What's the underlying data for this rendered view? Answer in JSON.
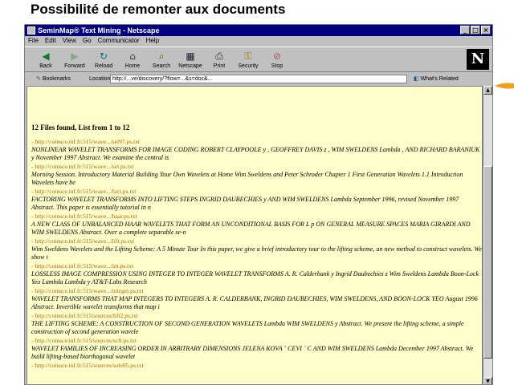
{
  "slide_title": "Possibilité de remonter aux documents",
  "window": {
    "title": "SeminMap® Text Mining - Netscape",
    "buttons": [
      "_",
      "□",
      "×"
    ]
  },
  "menu": [
    "File",
    "Edit",
    "View",
    "Go",
    "Communicator",
    "Help"
  ],
  "toolbar": [
    {
      "label": "Back",
      "icon": "back-arrow-icon"
    },
    {
      "label": "Forward",
      "icon": "forward-arrow-icon"
    },
    {
      "label": "Reload",
      "icon": "reload-icon"
    },
    {
      "label": "Home",
      "icon": "home-icon"
    },
    {
      "label": "Search",
      "icon": "search-icon"
    },
    {
      "label": "Netscape",
      "icon": "netscape-icon"
    },
    {
      "label": "Print",
      "icon": "print-icon"
    },
    {
      "label": "Security",
      "icon": "lock-icon"
    },
    {
      "label": "Stop",
      "icon": "stop-icon"
    }
  ],
  "brand": "N",
  "location": {
    "bookmarks_label": "Bookmarks",
    "location_label": "Location:",
    "url": "http://...ve/discovery/?flow=...&s=doc&...",
    "related_label": "What's Related"
  },
  "result": {
    "found_text": "12 Files found, List from 1 to 12",
    "items": [
      {
        "url": "- http://coinsce.inf.fr:515/wave.../sel97.ps.txt",
        "desc": "NONLINEAR WAVELET TRANSFORMS FOR IMAGE CODING ROBERT CLAYPOOLE y , GEOFFREY DAVIS z , WIM SWELDENS Lambda , AND RICHARD BARANIUK y November 1997 Abstract. We examine the central is"
      },
      {
        "url": "- http://coinsce.inf.fr:515/wave.../sel.ps.txt",
        "desc": "Morning Session. Introductory Material Building Your Own Wavelets at Home Wim Sweldens and Peter Schroder Chapter 1 First Generation Wavelets 1.1 Introduction Wavelets have be"
      },
      {
        "url": "- http://coinsce.inf.fr:515/wave.../fact.ps.txt",
        "desc": "FACTORING WAVELET TRANSFORMS INTO LIFTING STEPS INGRID DAUBECHIES y AND WIM SWELDENS Lambda September 1996, revised November 1997 Abstract. This paper is essentially tutorial in n"
      },
      {
        "url": "- http://coinsce.inf.fr:515/wave.../haar.ps.txt",
        "desc": "A NEW CLASS OF UNBALANCED HAAR WAVELETS THAT FORM AN UNCONDITIONAL BASIS FOR L p ON GENERAL MEASURE SPACES MARIA GIRARDI AND WIM SWELDENS Abstract. Over a complete separable se-n"
      },
      {
        "url": "- http://coinsce.inf.fr:515/wave.../lift.ps.txt",
        "desc": "Wim Sweldens Wavelets and the Lifting Scheme: A 5 Minute Tour In this paper, we give a brief introductory tour to the lifting scheme, an new method to construct wavelets. We show t"
      },
      {
        "url": "- http://coinsce.inf.fr:515/wave.../int.ps.txt",
        "desc": "LOSSLESS IMAGE COMPRESSION USING INTEGER TO INTEGER WAVELET TRANSFORMS A. R. Calderbank y Ingrid Daubechies z Wim Sweldens Lambda Boon-Lock Yeo Lambda Lambda y AT&T-Labs Research"
      },
      {
        "url": "- http://coinsce.inf.fr:515/wave.../integer.ps.txt",
        "desc": "WAVELET TRANSFORMS THAT MAP INTEGERS TO INTEGERS A. R. CALDERBANK, INGRID DAUBECHIES, WIM SWELDENS, AND BOON-LOCK YEO August 1996 Abstract. Invertible wavelet transforms that map i"
      },
      {
        "url": "- http://coinsce.inf.fr:515/sources/lift2.ps.txt",
        "desc": "THE LIFTING SCHEME: A CONSTRUCTION OF SECOND GENERATION WAVELETS Lambda WIM SWELDENS y Abstract. We present the lifting scheme, a simple construction of second generation wavele"
      },
      {
        "url": "- http://coinsce.inf.fr:515/sources/scft.ps.txt",
        "desc": "WAVELET FAMILIES OF INCREASING ORDER IN ARBITRARY DIMENSIONS JELENA KOVA ˇ CEVI ´ C AND WIM SWELDENS Lambda December 1997 Abstract. We build lifting-based biorthogonal wavelet"
      },
      {
        "url": "- http://coinsce.inf.fr:515/sources/sole95.ps.txt",
        "desc": ""
      }
    ]
  }
}
